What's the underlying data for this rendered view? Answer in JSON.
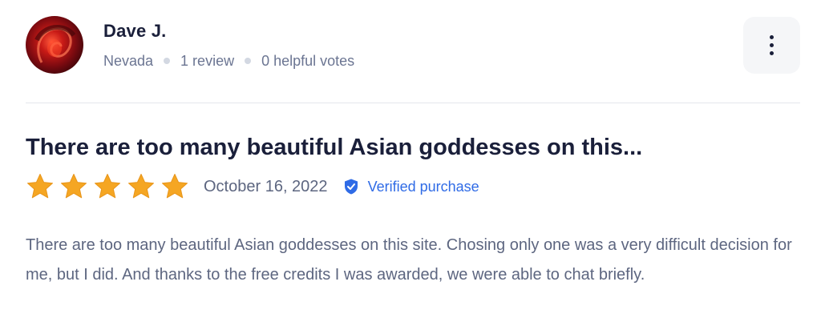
{
  "reviewer": {
    "name": "Dave J.",
    "location": "Nevada",
    "review_count": "1 review",
    "helpful_votes": "0 helpful votes",
    "avatar_icon": "avatar-photo"
  },
  "menu": {
    "icon": "vertical-ellipsis-icon"
  },
  "review": {
    "title": "There are too many beautiful Asian goddesses on this...",
    "rating": 5,
    "rating_max": 5,
    "date": "October 16, 2022",
    "verified_label": "Verified purchase",
    "body": "There are too many beautiful Asian goddesses on this site. Chosing only one was a very difficult decision for me, but I did. And thanks to the free credits I was awarded, we were able to chat briefly."
  },
  "colors": {
    "star": "#f5a623",
    "verified": "#2f6be6",
    "title": "#1a1f3a",
    "muted_text": "#5d6680"
  }
}
